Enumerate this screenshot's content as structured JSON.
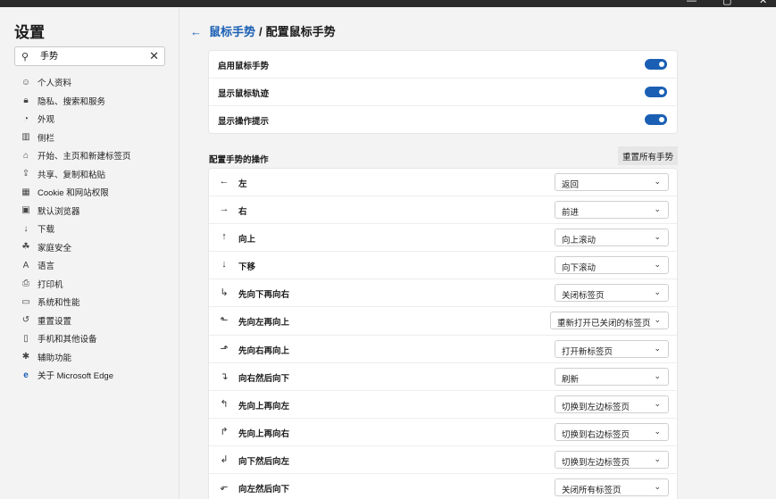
{
  "window": {
    "controls": [
      "—",
      "▢",
      "✕"
    ]
  },
  "sidebar": {
    "title": "设置",
    "search": {
      "value": "手势",
      "icon": "search-icon",
      "clear_icon": "close-icon"
    },
    "items": [
      {
        "label": "个人资料",
        "icon": "profile-icon",
        "glyph": "☺"
      },
      {
        "label": "隐私、搜索和服务",
        "icon": "lock-icon",
        "glyph": "🔒︎"
      },
      {
        "label": "外观",
        "icon": "appearance-icon",
        "glyph": "◔"
      },
      {
        "label": "侧栏",
        "icon": "sidebar-icon",
        "glyph": "▥"
      },
      {
        "label": "开始、主页和新建标签页",
        "icon": "home-tab-icon",
        "glyph": "⌂"
      },
      {
        "label": "共享、复制和粘贴",
        "icon": "share-icon",
        "glyph": "⇪"
      },
      {
        "label": "Cookie 和网站权限",
        "icon": "cookie-icon",
        "glyph": "▦"
      },
      {
        "label": "默认浏览器",
        "icon": "browser-icon",
        "glyph": "▣"
      },
      {
        "label": "下载",
        "icon": "download-icon",
        "glyph": "↓"
      },
      {
        "label": "家庭安全",
        "icon": "family-icon",
        "glyph": "☘"
      },
      {
        "label": "语言",
        "icon": "language-icon",
        "glyph": "A"
      },
      {
        "label": "打印机",
        "icon": "printer-icon",
        "glyph": "⎙"
      },
      {
        "label": "系统和性能",
        "icon": "laptop-icon",
        "glyph": "▭"
      },
      {
        "label": "重置设置",
        "icon": "reset-icon",
        "glyph": "↺"
      },
      {
        "label": "手机和其他设备",
        "icon": "phone-icon",
        "glyph": "▯"
      },
      {
        "label": "辅助功能",
        "icon": "accessibility-icon",
        "glyph": "✱"
      },
      {
        "label": "关于 Microsoft Edge",
        "icon": "edge-logo-icon",
        "glyph": "e"
      }
    ]
  },
  "header": {
    "back_glyph": "←",
    "parent": "鼠标手势",
    "separator": "/",
    "current": "配置鼠标手势"
  },
  "toggles": [
    {
      "label": "启用鼠标手势",
      "on": true
    },
    {
      "label": "显示鼠标轨迹",
      "on": true
    },
    {
      "label": "显示操作提示",
      "on": true
    }
  ],
  "gestures_section": {
    "title": "配置手势的操作",
    "reset_label": "重置所有手势",
    "rows": [
      {
        "label": "左",
        "glyph": "←",
        "icon": "arrow-left-icon",
        "action": "返回"
      },
      {
        "label": "右",
        "glyph": "→",
        "icon": "arrow-right-icon",
        "action": "前进"
      },
      {
        "label": "向上",
        "glyph": "↑",
        "icon": "arrow-up-icon",
        "action": "向上滚动"
      },
      {
        "label": "下移",
        "glyph": "↓",
        "icon": "arrow-down-icon",
        "action": "向下滚动"
      },
      {
        "label": "先向下再向右",
        "glyph": "↳",
        "icon": "down-right-icon",
        "action": "关闭标签页"
      },
      {
        "label": "先向左再向上",
        "glyph": "⬑",
        "icon": "left-up-icon",
        "action": "重新打开已关闭的标签页"
      },
      {
        "label": "先向右再向上",
        "glyph": "⬏",
        "icon": "right-up-icon",
        "action": "打开新标签页"
      },
      {
        "label": "向右然后向下",
        "glyph": "↴",
        "icon": "right-down-icon",
        "action": "刷新"
      },
      {
        "label": "先向上再向左",
        "glyph": "↰",
        "icon": "up-left-icon",
        "action": "切换到左边标签页"
      },
      {
        "label": "先向上再向右",
        "glyph": "↱",
        "icon": "up-right-icon",
        "action": "切换到右边标签页"
      },
      {
        "label": "向下然后向左",
        "glyph": "↲",
        "icon": "down-left-icon",
        "action": "切换到左边标签页"
      },
      {
        "label": "向左然后向下",
        "glyph": "⬐",
        "icon": "left-down-icon",
        "action": "关闭所有标签页"
      }
    ],
    "chevron": "⌄"
  }
}
